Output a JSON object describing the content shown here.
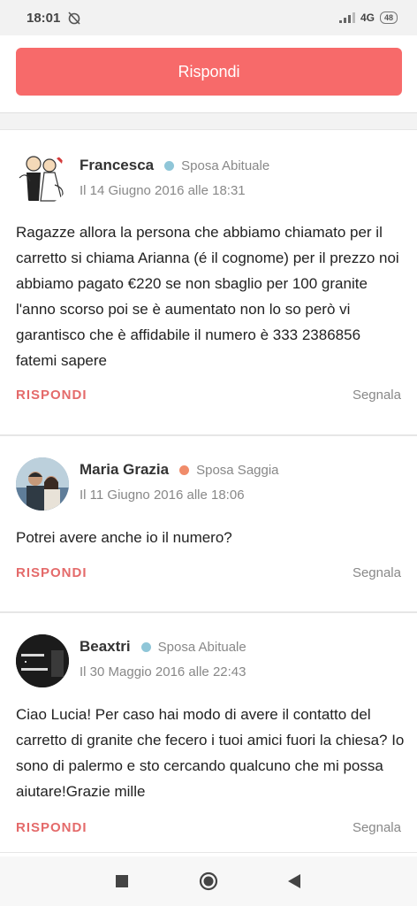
{
  "status": {
    "time": "18:01",
    "network": "4G",
    "battery": "48"
  },
  "reply_button_label": "Rispondi",
  "posts": [
    {
      "name": "Francesca",
      "badge": "Sposa Abituale",
      "badge_color": "#8fc6d8",
      "date": "Il 14 Giugno 2016 alle 18:31",
      "text": "Ragazze allora la persona che abbiamo chiamato per il carretto si chiama Arianna (é il cognome) per il prezzo noi abbiamo pagato €220 se non sbaglio per 100 granite l'anno scorso poi se è aumentato non lo so però vi garantisco che è affidabile il numero è 333 2386856 fatemi sapere",
      "reply_label": "RISPONDI",
      "report_label": "Segnala"
    },
    {
      "name": "Maria Grazia",
      "badge": "Sposa Saggia",
      "badge_color": "#f08c6a",
      "date": "Il 11 Giugno 2016 alle 18:06",
      "text": "Potrei avere anche io il numero?",
      "reply_label": "RISPONDI",
      "report_label": "Segnala"
    },
    {
      "name": "Beaxtri",
      "badge": "Sposa Abituale",
      "badge_color": "#8fc6d8",
      "date": "Il 30 Maggio 2016 alle 22:43",
      "text": "Ciao Lucia! Per caso hai modo di avere il contatto del carretto di granite che fecero i tuoi amici fuori la chiesa? Io sono di palermo e sto cercando qualcuno che mi possa aiutare!Grazie mille",
      "reply_label": "RISPONDI",
      "report_label": "Segnala"
    }
  ]
}
